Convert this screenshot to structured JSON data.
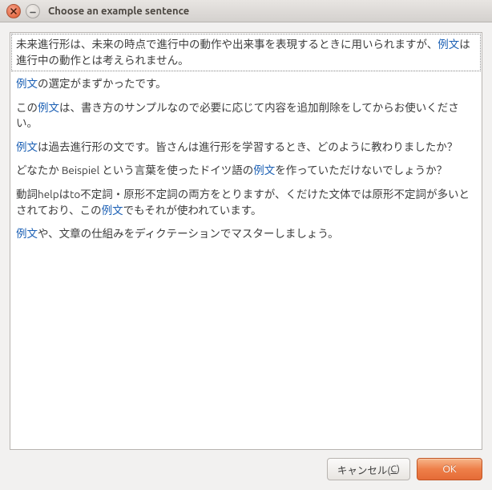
{
  "window": {
    "title": "Choose an example sentence"
  },
  "highlight_word": "例文",
  "sentences": [
    {
      "segments": [
        {
          "t": "未来進行形は、未来の時点で進行中の動作や出来事を表現するときに用いられますが、"
        },
        {
          "t": "例文",
          "h": true
        },
        {
          "t": "は進行中の動作とは考えられません。"
        }
      ]
    },
    {
      "segments": [
        {
          "t": "例文",
          "h": true
        },
        {
          "t": "の選定がまずかったです。"
        }
      ]
    },
    {
      "segments": [
        {
          "t": "この"
        },
        {
          "t": "例文",
          "h": true
        },
        {
          "t": "は、書き方のサンプルなので必要に応じて内容を追加削除をしてからお使いください。"
        }
      ]
    },
    {
      "segments": [
        {
          "t": "例文",
          "h": true
        },
        {
          "t": "は過去進行形の文です。皆さんは進行形を学習するとき、どのように教わりましたか？"
        }
      ]
    },
    {
      "segments": [
        {
          "t": "どなたか Beispiel という言葉を使ったドイツ語の"
        },
        {
          "t": "例文",
          "h": true
        },
        {
          "t": "を作っていただけないでしょうか？"
        }
      ]
    },
    {
      "segments": [
        {
          "t": "動詞helpはto不定詞・原形不定詞の両方をとりますが、くだけた文体では原形不定詞が多いとされており、この"
        },
        {
          "t": "例文",
          "h": true
        },
        {
          "t": "でもそれが使われています。"
        }
      ]
    },
    {
      "segments": [
        {
          "t": "例文",
          "h": true
        },
        {
          "t": "や、文章の仕組みをディクテーションでマスターしましょう。"
        }
      ]
    }
  ],
  "selected_index": 0,
  "buttons": {
    "cancel": "キャンセル(",
    "cancel_mnemonic": "C",
    "cancel_suffix": ")",
    "ok": "OK"
  }
}
